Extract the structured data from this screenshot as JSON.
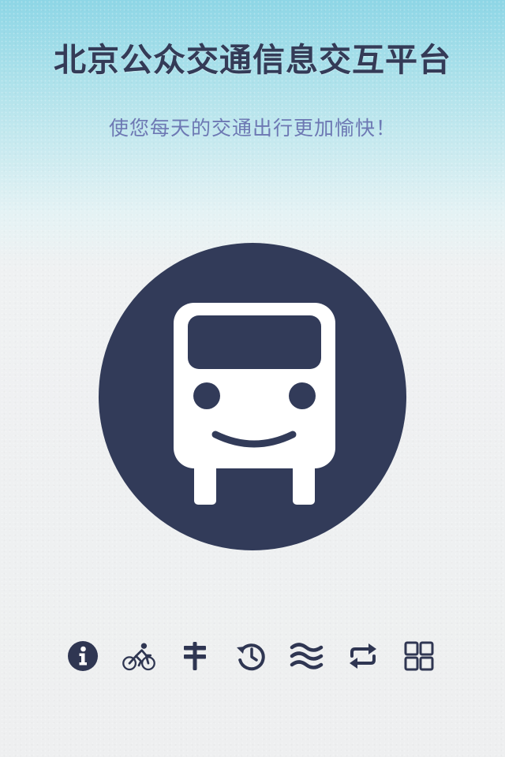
{
  "header": {
    "title": "北京公众交通信息交互平台",
    "subtitle": "使您每天的交通出行更加愉快！"
  },
  "logo": {
    "icon": "smiling-bus-icon",
    "circle_color": "#323b59",
    "glyph_color": "#ffffff"
  },
  "toolbar": {
    "icon_color": "#2f3652",
    "items": [
      {
        "icon": "info-icon"
      },
      {
        "icon": "bicycle-icon"
      },
      {
        "icon": "signpost-icon"
      },
      {
        "icon": "history-icon"
      },
      {
        "icon": "waves-icon"
      },
      {
        "icon": "repeat-icon"
      },
      {
        "icon": "grid-icon"
      }
    ]
  },
  "colors": {
    "title": "#343b57",
    "subtitle": "#6d78b3",
    "sky_top": "#8ed6e6",
    "paper": "#eeeff0"
  }
}
